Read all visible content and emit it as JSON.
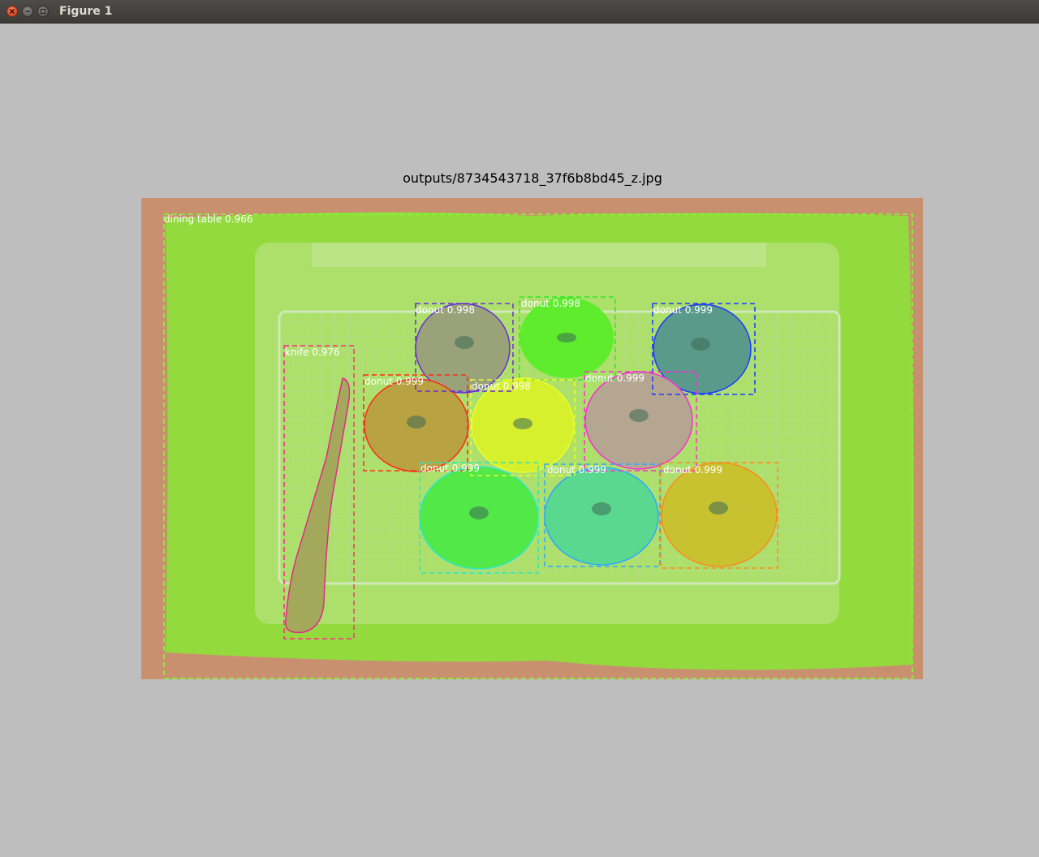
{
  "window": {
    "title": "Figure 1",
    "buttons": {
      "close": "close-icon",
      "minimize": "minimize-icon",
      "maximize": "maximize-icon"
    }
  },
  "figure": {
    "title": "outputs/8734543718_37f6b8bd45_z.jpg"
  },
  "detections": [
    {
      "label": "dining table 0.966",
      "color": "#7cff2e"
    },
    {
      "label": "knife 0.976",
      "color": "#ff2a8a"
    },
    {
      "label": "donut 0.998",
      "color": "#6a2cd8"
    },
    {
      "label": "donut 0.998",
      "color": "#2ee82a"
    },
    {
      "label": "donut 0.999",
      "color": "#1c3aff"
    },
    {
      "label": "donut 0.999",
      "color": "#ff2a1a"
    },
    {
      "label": "donut 0.998",
      "color": "#e8ff2a"
    },
    {
      "label": "donut 0.999",
      "color": "#ff2ad8"
    },
    {
      "label": "donut 0.999",
      "color": "#2ae8c8"
    },
    {
      "label": "donut 0.999",
      "color": "#2aa8ff"
    },
    {
      "label": "donut 0.999",
      "color": "#ff8a1a"
    }
  ]
}
